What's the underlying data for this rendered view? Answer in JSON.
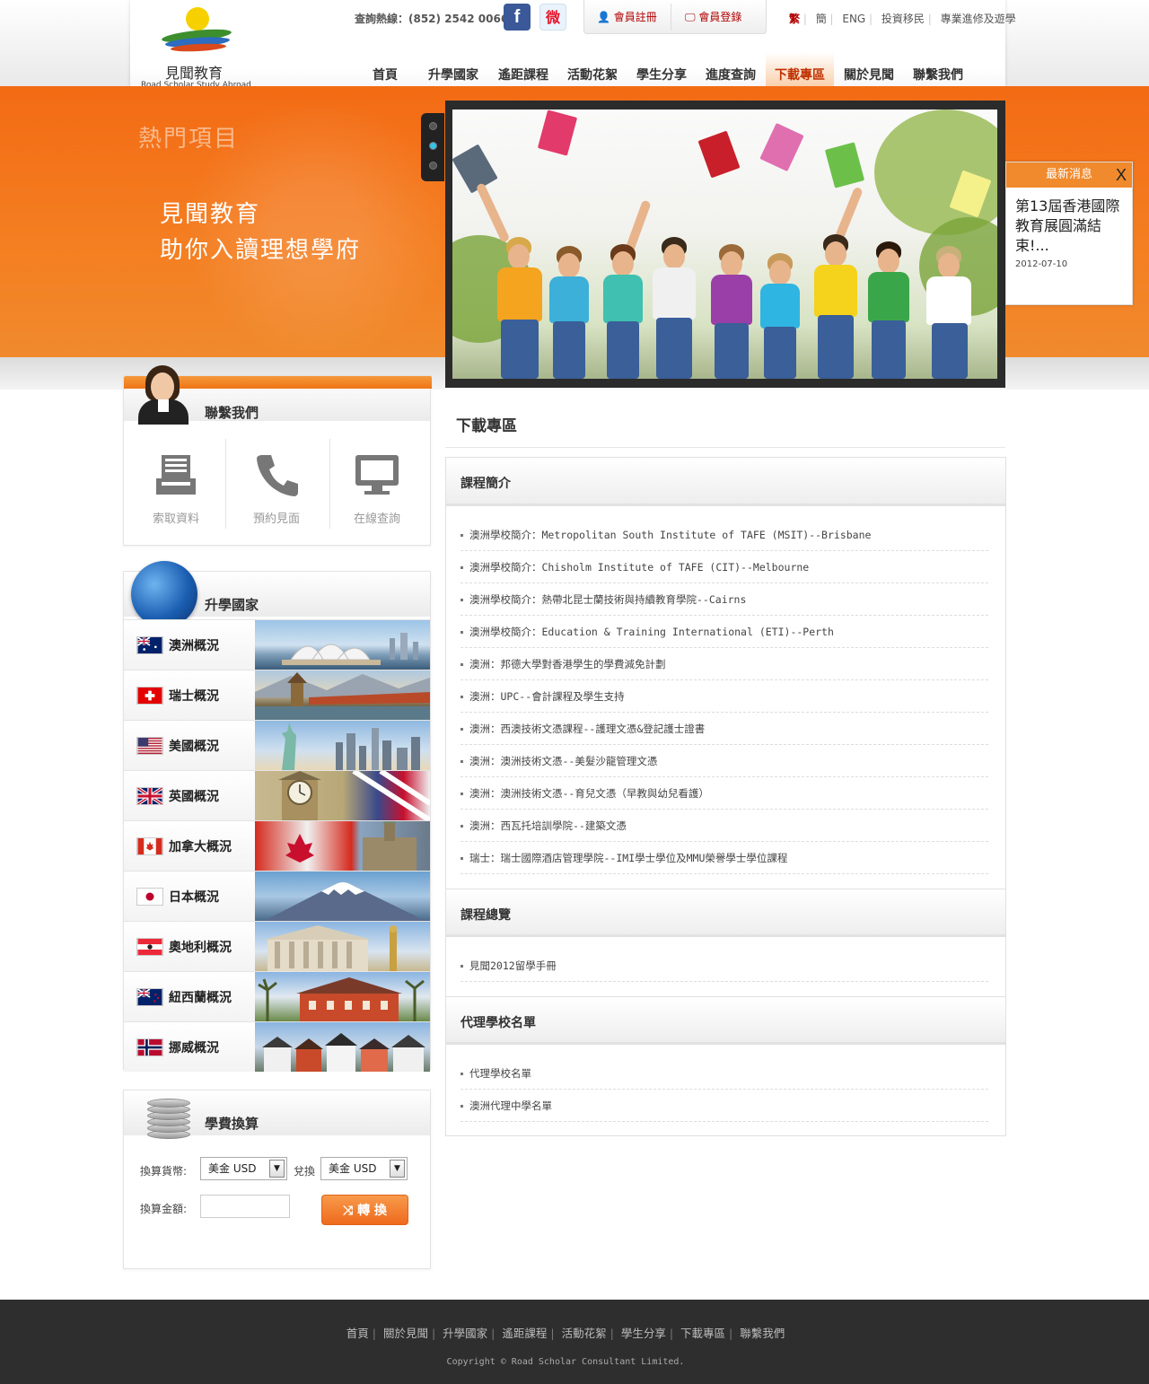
{
  "header": {
    "logo_cn": "見聞教育",
    "logo_en": "Road Scholar Study Abroad",
    "hotline": "查詢熱線：(852) 2542 0066",
    "facebook_glyph": "f",
    "weibo_glyph": "微",
    "register_label": "會員註冊",
    "login_label": "會員登錄",
    "lang": [
      {
        "label": "繁",
        "active": true
      },
      {
        "label": "簡",
        "active": false
      },
      {
        "label": "ENG",
        "active": false
      },
      {
        "label": "投資移民",
        "active": false
      },
      {
        "label": "專業進修及遊學",
        "active": false
      }
    ]
  },
  "nav": [
    {
      "label": "首頁",
      "active": false
    },
    {
      "label": "升學國家",
      "active": false
    },
    {
      "label": "遙距課程",
      "active": false
    },
    {
      "label": "活動花絮",
      "active": false
    },
    {
      "label": "學生分享",
      "active": false
    },
    {
      "label": "進度查詢",
      "active": false
    },
    {
      "label": "下載專區",
      "active": true
    },
    {
      "label": "關於見聞",
      "active": false
    },
    {
      "label": "聯繫我們",
      "active": false
    }
  ],
  "banner": {
    "hot_title": "熱門項目",
    "slogan_line1": "見聞教育",
    "slogan_line2": "助你入讀理想學府"
  },
  "news": {
    "title": "最新消息",
    "close": "X",
    "text": "第13屆香港國際教育展圓滿結束!...",
    "date": "2012-07-10"
  },
  "contact": {
    "title": "聯繫我們",
    "tools": [
      "索取資料",
      "預約見面",
      "在線查詢"
    ]
  },
  "countries": {
    "title": "升學國家",
    "items": [
      "澳洲概況",
      "瑞士概況",
      "美國概況",
      "英國概況",
      "加拿大概況",
      "日本概況",
      "奧地利概況",
      "紐西蘭概況",
      "挪威概況"
    ]
  },
  "fee": {
    "title": "學費換算",
    "currency_label": "換算貨幣:",
    "to_label": "兌換",
    "from_value": "美金 USD",
    "to_value": "美金 USD",
    "amount_label": "換算金額:",
    "convert_label": "轉 換",
    "convert_icon": "⤨"
  },
  "main": {
    "title": "下載專區",
    "sections": [
      {
        "title": "課程簡介",
        "items": [
          "澳洲學校簡介：Metropolitan South Institute of TAFE (MSIT)--Brisbane",
          "澳洲學校簡介：Chisholm Institute of TAFE (CIT)--Melbourne",
          "澳洲學校簡介：熱帶北昆士蘭技術與持續教育學院--Cairns",
          "澳洲學校簡介：Education & Training International (ETI)--Perth",
          "澳洲：邦德大學對香港學生的學費減免計劃",
          "澳洲：UPC--會計課程及學生支持",
          "澳洲：西澳技術文憑課程--護理文憑&登記護士證書",
          "澳洲：澳洲技術文憑--美髮沙龍管理文憑",
          "澳洲：澳洲技術文憑--育兒文憑（早教與幼兒看護）",
          "澳洲：西瓦托培訓學院--建築文憑",
          "瑞士：瑞士國際酒店管理學院--IMI學士學位及MMU榮譽學士學位課程"
        ]
      },
      {
        "title": "課程總覽",
        "items": [
          "見聞2012留學手冊"
        ]
      },
      {
        "title": "代理學校名單",
        "items": [
          "代理學校名單",
          "澳洲代理中學名單"
        ]
      }
    ]
  },
  "footer": {
    "links": [
      "首頁",
      "關於見聞",
      "升學國家",
      "遙距課程",
      "活動花絮",
      "學生分享",
      "下載專區",
      "聯繫我們"
    ],
    "copyright": "Copyright © Road Scholar Consultant Limited."
  },
  "colors": {
    "accent_orange": "#f36b14",
    "active_red": "#b00000",
    "footer_bg": "#2e2e2e"
  }
}
